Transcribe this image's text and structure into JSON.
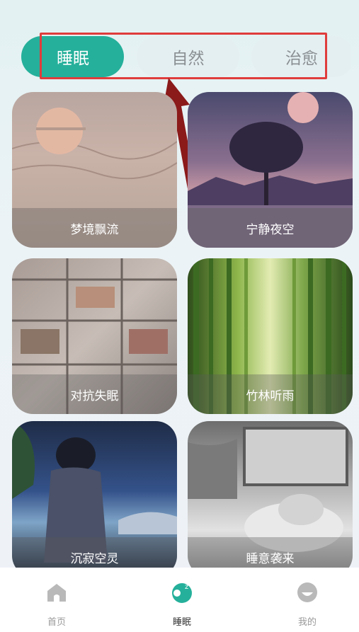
{
  "tabs": [
    {
      "label": "睡眠",
      "active": true
    },
    {
      "label": "自然",
      "active": false
    },
    {
      "label": "治愈",
      "active": false
    }
  ],
  "cards": [
    {
      "title": "梦境飘流"
    },
    {
      "title": "宁静夜空"
    },
    {
      "title": "对抗失眠"
    },
    {
      "title": "竹林听雨"
    },
    {
      "title": "沉寂空灵"
    },
    {
      "title": "睡意袭来"
    }
  ],
  "tabbar": {
    "home": "首页",
    "sleep": "睡眠",
    "me": "我的"
  },
  "colors": {
    "accent": "#25b09b",
    "highlight": "#e03c3c",
    "arrow": "#8b1a1a"
  }
}
